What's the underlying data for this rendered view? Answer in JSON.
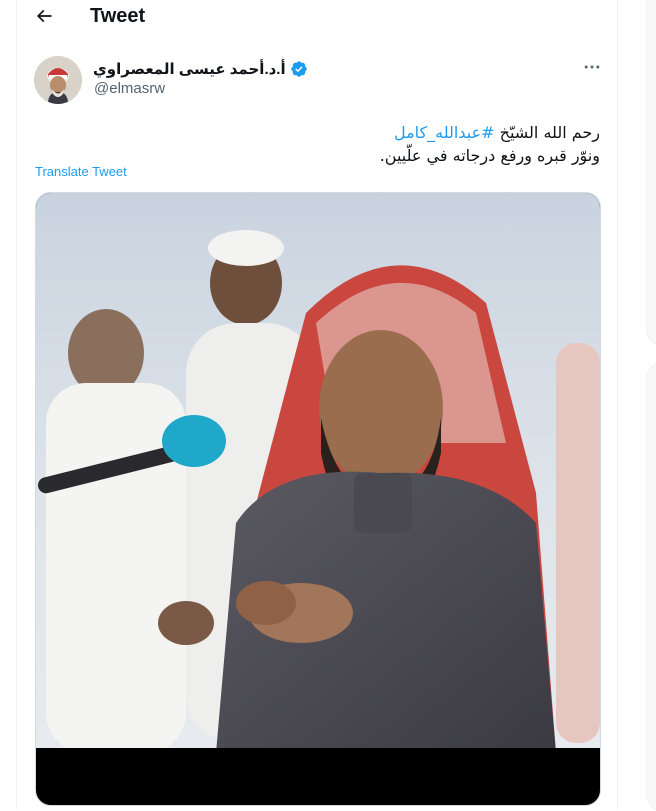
{
  "header": {
    "title": "Tweet",
    "back_icon": "arrow-left-icon"
  },
  "tweet": {
    "author_name": "أ.د.أحمد عيسى المعصراوي",
    "author_handle": "@elmasrw",
    "verified_icon": "verified-badge-icon",
    "more_icon": "more-horizontal-icon",
    "text_line1_prefix": "رحم الله الشيّخ ",
    "text_line1_hashtag": "#عبدالله_كامل",
    "text_line2": "ونوّر قبره ورفع درجاته في علّيين.",
    "translate_label": "Translate Tweet"
  },
  "colors": {
    "accent": "#1d9bf0",
    "secondary_text": "#536471",
    "border": "#eff3f4"
  }
}
